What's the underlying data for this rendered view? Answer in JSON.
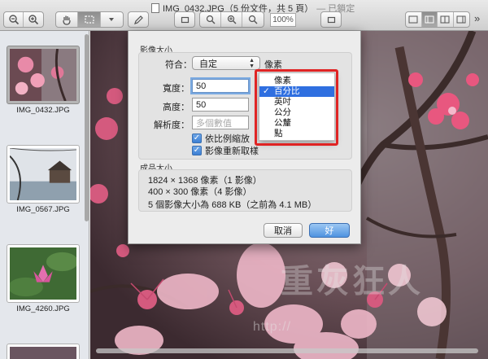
{
  "window": {
    "title": "IMG_0432.JPG（5 份文件，共 5 頁）",
    "locked_label": "— 已鎖定",
    "zoom_value": "100%"
  },
  "toolbar": {
    "zoom_out_icon": "zoom-out-icon",
    "zoom_in_icon": "zoom-in-icon",
    "hand_icon": "hand-icon",
    "select_icon": "selection-icon",
    "pen_icon": "pen-icon",
    "more_label": "»"
  },
  "sidebar": {
    "thumbnails": [
      {
        "name": "IMG_0432.JPG",
        "selected": true
      },
      {
        "name": "IMG_0567.JPG",
        "selected": false
      },
      {
        "name": "IMG_4260.JPG",
        "selected": false
      }
    ]
  },
  "dialog": {
    "image_size_label": "影像大小",
    "fit_label": "符合：",
    "fit_value": "自定",
    "unit_label": "像素",
    "width_label": "寬度：",
    "width_value": "50",
    "height_label": "高度：",
    "height_value": "50",
    "resolution_label": "解析度：",
    "resolution_placeholder": "多個數值",
    "scale_proportionally": "依比例縮放",
    "resample": "影像重新取樣",
    "result_size_label": "成品大小",
    "result_line1": "1824 × 1368 像素（1 影像）",
    "result_line2": "400 × 300 像素（4 影像）",
    "result_line3": "5 個影像大小為 688 KB（之前為 4.1 MB）",
    "cancel_label": "取消",
    "ok_label": "好"
  },
  "unit_menu": {
    "items": [
      "像素",
      "百分比",
      "英吋",
      "公分",
      "公釐",
      "點"
    ],
    "selected_index": 1,
    "checkmark": "✓"
  },
  "watermark": {
    "text": "http://",
    "big": "重灰狂人"
  }
}
